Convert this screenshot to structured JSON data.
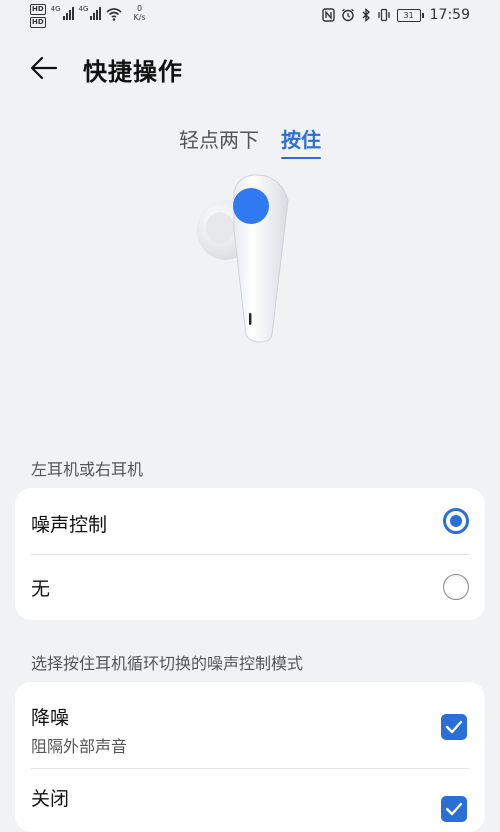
{
  "status_bar": {
    "left_badges": [
      "HD",
      "HD"
    ],
    "signal_1_type": "4G",
    "signal_2_type": "4G",
    "net_speed_value": "0",
    "net_speed_unit": "K/s",
    "battery_level": "31",
    "time": "17:59"
  },
  "app_bar": {
    "title": "快捷操作"
  },
  "tabs": [
    {
      "label": "轻点两下",
      "active": false
    },
    {
      "label": "按住",
      "active": true
    }
  ],
  "section_earbud_side": {
    "header": "左耳机或右耳机",
    "options": [
      {
        "label": "噪声控制",
        "selected": true
      },
      {
        "label": "无",
        "selected": false
      }
    ]
  },
  "section_noise_modes": {
    "header": "选择按住耳机循环切换的噪声控制模式",
    "items": [
      {
        "label": "降噪",
        "sublabel": "阻隔外部声音",
        "checked": true
      },
      {
        "label": "关闭",
        "checked": true
      }
    ]
  },
  "colors": {
    "accent": "#2a6fd6",
    "background": "#f1f2f4",
    "card": "#ffffff"
  }
}
